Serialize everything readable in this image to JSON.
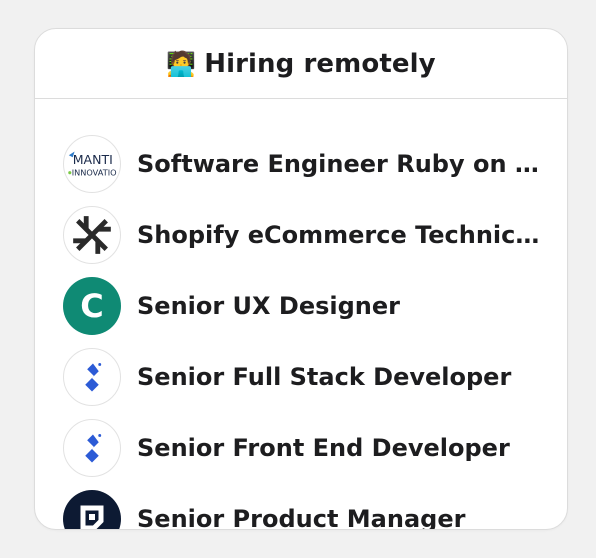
{
  "panel": {
    "emoji": "🧑‍💻",
    "title": "Hiring remotely"
  },
  "jobs": [
    {
      "title": "Software Engineer Ruby on Rails",
      "logo_text": "MANTI INNOVATIO",
      "logo_icon": "mantis-innovation-logo"
    },
    {
      "title": "Shopify eCommerce Technical Lead",
      "logo_icon": "crossed-arrows-logo"
    },
    {
      "title": "Senior UX Designer",
      "logo_letter": "C",
      "logo_icon": "letter-c-logo"
    },
    {
      "title": "Senior Full Stack Developer",
      "logo_icon": "toptal-logo"
    },
    {
      "title": "Senior Front End Developer",
      "logo_icon": "toptal-logo"
    },
    {
      "title": "Senior Product Manager",
      "logo_icon": "square-bracket-logo"
    }
  ],
  "colors": {
    "background": "#f1f1f1",
    "card": "#ffffff",
    "border": "#dcdcdc",
    "text": "#1d1d1f",
    "green_logo": "#0f8a74",
    "navy_logo": "#0d1a33",
    "toptal_blue": "#2c5bd6"
  }
}
